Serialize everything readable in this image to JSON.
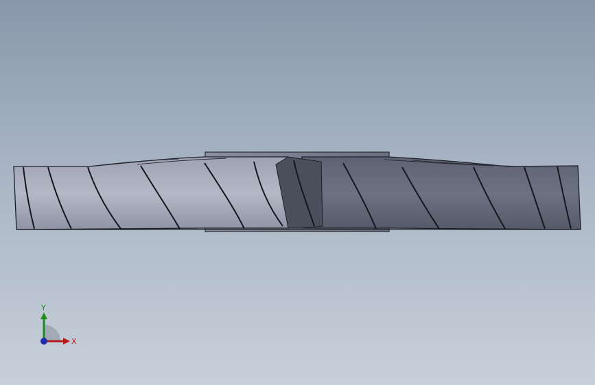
{
  "viewport": {
    "background_top": "#8898aa",
    "background_bottom": "#c7d0da"
  },
  "model": {
    "name": "fan-blade-impeller",
    "fill": "#7c8190",
    "edge": "#1c1f26"
  },
  "triad": {
    "x_label": "X",
    "y_label": "Y",
    "x_color": "#b51c1c",
    "y_color": "#1e8a1e",
    "z_color": "#1f2fb0"
  }
}
